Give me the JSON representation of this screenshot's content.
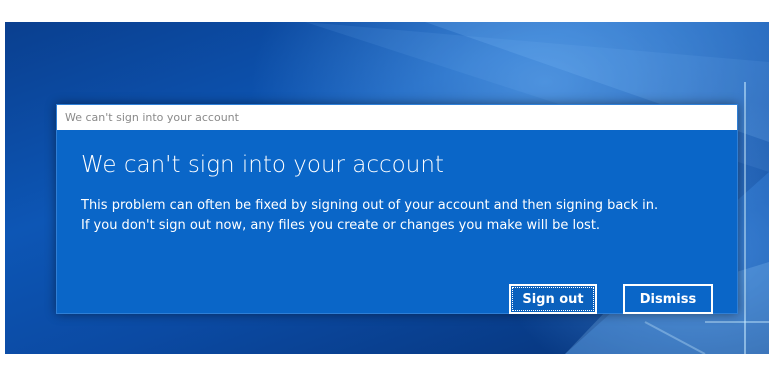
{
  "dialog": {
    "window_title": "We can't sign into your account",
    "heading": "We can't sign into your account",
    "message_line_1": "This problem can often be fixed by signing out of your account and then signing back in.",
    "message_line_2": "If you don't sign out now, any files you create or changes you make will be lost.",
    "buttons": {
      "sign_out": "Sign out",
      "dismiss": "Dismiss"
    }
  },
  "colors": {
    "dialog_body": "#0a66c8",
    "desktop_blue": "#0d56b5",
    "title_text": "#8a8a8a"
  }
}
